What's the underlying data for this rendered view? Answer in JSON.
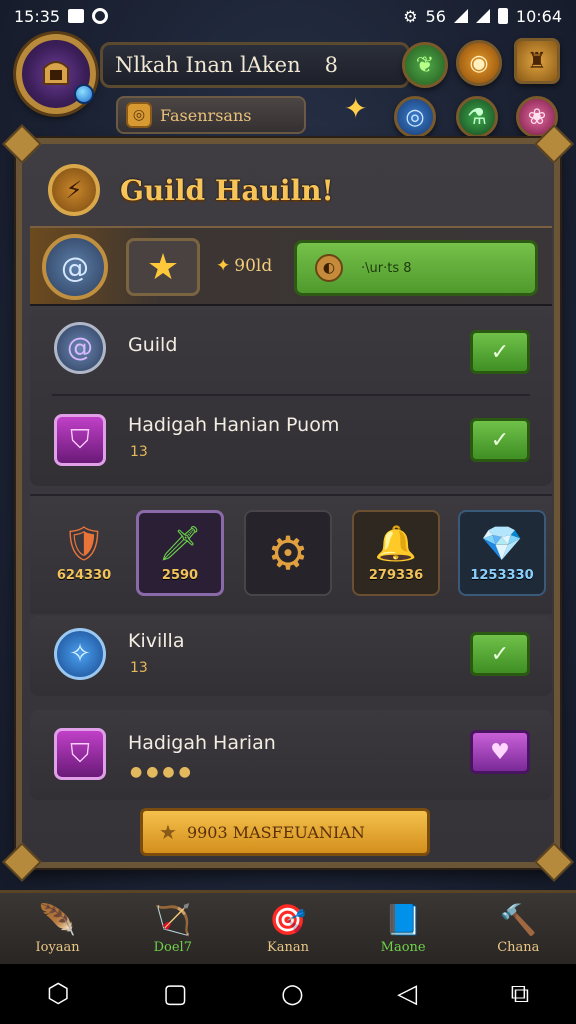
{
  "status_bar": {
    "time_left": "15:35",
    "time_right": "10:64",
    "signal_text": "56"
  },
  "profile": {
    "name": "Nlkah Inan lAken",
    "level": "8",
    "currency_label": "Fasenrsans"
  },
  "panel": {
    "title": "Guild Hauiln!",
    "featured": {
      "gold_amount": "90ld",
      "button_text": "·\\ur·ts 8"
    },
    "tasks": [
      {
        "title": "Guild",
        "subtitle": "",
        "action": "✓"
      },
      {
        "title": "Hadigah Hanian Puom",
        "subtitle": "13",
        "action": "✓"
      }
    ],
    "items": [
      {
        "name": "shield",
        "value": "624330",
        "glyph": "🛡"
      },
      {
        "name": "green-gem-spear",
        "value": "2590",
        "glyph": "🗡"
      },
      {
        "name": "golden-drill",
        "value": "",
        "glyph": "⚙"
      },
      {
        "name": "golden-horn",
        "value": "279336",
        "glyph": "🔔"
      },
      {
        "name": "blue-crystal",
        "value": "1253330",
        "glyph": "💎"
      }
    ],
    "tasks2": [
      {
        "title": "Kivilla",
        "subtitle": "13",
        "action": "✓"
      },
      {
        "title": "Hadigah Harian",
        "subtitle": "",
        "action": "♥"
      }
    ],
    "claim_button": "9903 MASFEUANIAN"
  },
  "bottom_nav": [
    {
      "label": "Ioyaan",
      "glyph": "🪶",
      "color": "#e9c785"
    },
    {
      "label": "Doel7",
      "glyph": "🏹",
      "color": "#6fd24a"
    },
    {
      "label": "Kanan",
      "glyph": "🎯",
      "color": "#e9c785"
    },
    {
      "label": "Maone",
      "glyph": "📘",
      "color": "#6fd24a"
    },
    {
      "label": "Chana",
      "glyph": "🔨",
      "color": "#e9c785"
    }
  ],
  "colors": {
    "gold": "#f6c458",
    "green_button": "#5aa83a",
    "panel_bg": "#3a383c",
    "frame": "#6a5637"
  }
}
